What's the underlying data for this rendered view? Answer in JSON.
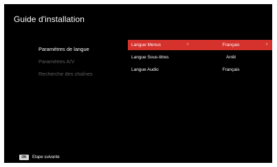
{
  "title": "Guide d'installation",
  "left_menu": {
    "items": [
      {
        "label": "Paramètres de langue"
      },
      {
        "label": "Paramètres A/V"
      },
      {
        "label": "Recherche des chaînes"
      }
    ]
  },
  "settings": {
    "rows": [
      {
        "label": "Langue Menus",
        "value": "Français"
      },
      {
        "label": "Langue Sous-titres",
        "value": "Arrêt"
      },
      {
        "label": "Langue Audio",
        "value": "Français"
      }
    ],
    "arrow_left": "‹",
    "arrow_right": "›"
  },
  "footer": {
    "key": "OK",
    "label": "Etape suivante"
  },
  "colors": {
    "background": "#000000",
    "highlight": "#d6322d",
    "disabled_text": "#5f5f5f"
  }
}
